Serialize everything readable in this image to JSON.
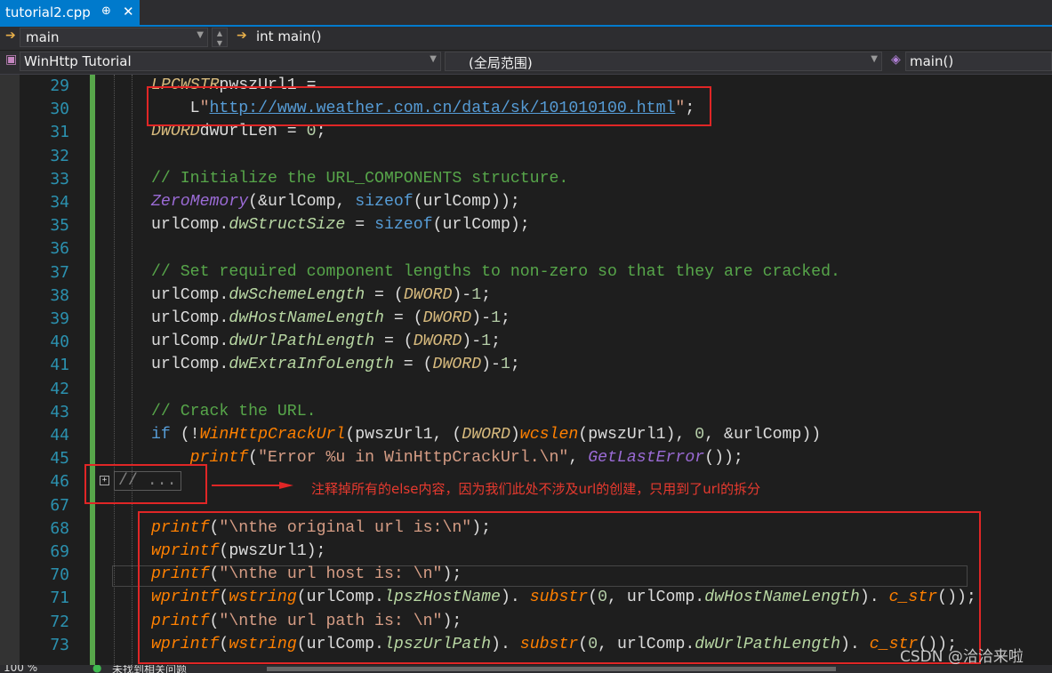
{
  "tab": {
    "title": "tutorial2.cpp",
    "pin": "⊕",
    "close": "✕"
  },
  "nav1": {
    "scope": "main",
    "function": "int main()"
  },
  "nav2": {
    "project": "WinHttp Tutorial",
    "scope": "(全局范围)",
    "member": "main()"
  },
  "code_lines": [
    {
      "num": "29",
      "tokens": [
        [
          "t",
          "LPCWSTR"
        ],
        [
          "",
          "pwszUrl1 ="
        ]
      ]
    },
    {
      "num": "30",
      "indent": 4,
      "tokens": [
        [
          "",
          "L"
        ],
        [
          "s",
          "\""
        ],
        [
          "u",
          "http://www.weather.com.cn/data/sk/101010100.html"
        ],
        [
          "s",
          "\""
        ],
        [
          "",
          ";"
        ]
      ]
    },
    {
      "num": "31",
      "tokens": [
        [
          "t",
          "DWORD"
        ],
        [
          "",
          "dwUrlLen = "
        ],
        [
          "n",
          "0"
        ],
        [
          "",
          ";"
        ]
      ]
    },
    {
      "num": "32",
      "tokens": []
    },
    {
      "num": "33",
      "tokens": [
        [
          "c",
          "// Initialize the URL_COMPONENTS structure."
        ]
      ]
    },
    {
      "num": "34",
      "tokens": [
        [
          "m",
          "ZeroMemory"
        ],
        [
          "",
          "(&urlComp, "
        ],
        [
          "k",
          "sizeof"
        ],
        [
          "",
          "(urlComp));"
        ]
      ]
    },
    {
      "num": "35",
      "tokens": [
        [
          "",
          "urlComp."
        ],
        [
          "v",
          "dwStructSize"
        ],
        [
          "",
          " = "
        ],
        [
          "k",
          "sizeof"
        ],
        [
          "",
          "(urlComp);"
        ]
      ]
    },
    {
      "num": "36",
      "tokens": []
    },
    {
      "num": "37",
      "tokens": [
        [
          "c",
          "// Set required component lengths to non-zero so that they are cracked."
        ]
      ]
    },
    {
      "num": "38",
      "tokens": [
        [
          "",
          "urlComp."
        ],
        [
          "v",
          "dwSchemeLength"
        ],
        [
          "",
          " = ("
        ],
        [
          "t",
          "DWORD"
        ],
        [
          "",
          ")-"
        ],
        [
          "n",
          "1"
        ],
        [
          "",
          ";"
        ]
      ]
    },
    {
      "num": "39",
      "tokens": [
        [
          "",
          "urlComp."
        ],
        [
          "v",
          "dwHostNameLength"
        ],
        [
          "",
          " = ("
        ],
        [
          "t",
          "DWORD"
        ],
        [
          "",
          ")-"
        ],
        [
          "n",
          "1"
        ],
        [
          "",
          ";"
        ]
      ]
    },
    {
      "num": "40",
      "tokens": [
        [
          "",
          "urlComp."
        ],
        [
          "v",
          "dwUrlPathLength"
        ],
        [
          "",
          " = ("
        ],
        [
          "t",
          "DWORD"
        ],
        [
          "",
          ")-"
        ],
        [
          "n",
          "1"
        ],
        [
          "",
          ";"
        ]
      ]
    },
    {
      "num": "41",
      "tokens": [
        [
          "",
          "urlComp."
        ],
        [
          "v",
          "dwExtraInfoLength"
        ],
        [
          "",
          " = ("
        ],
        [
          "t",
          "DWORD"
        ],
        [
          "",
          ")-"
        ],
        [
          "n",
          "1"
        ],
        [
          "",
          ";"
        ]
      ]
    },
    {
      "num": "42",
      "tokens": []
    },
    {
      "num": "43",
      "tokens": [
        [
          "c",
          "// Crack the URL."
        ]
      ]
    },
    {
      "num": "44",
      "tokens": [
        [
          "k",
          "if"
        ],
        [
          "",
          " (!"
        ],
        [
          "f",
          "WinHttpCrackUrl"
        ],
        [
          "",
          "(pwszUrl1, ("
        ],
        [
          "t",
          "DWORD"
        ],
        [
          "",
          ")"
        ],
        [
          "f",
          "wcslen"
        ],
        [
          "",
          "(pwszUrl1), "
        ],
        [
          "n",
          "0"
        ],
        [
          "",
          ", &urlComp))"
        ]
      ]
    },
    {
      "num": "45",
      "indent": 4,
      "tokens": [
        [
          "f",
          "printf"
        ],
        [
          "",
          "("
        ],
        [
          "s",
          "\"Error %u in WinHttpCrackUrl.\\n\""
        ],
        [
          "",
          ", "
        ],
        [
          "m",
          "GetLastError"
        ],
        [
          "",
          "());"
        ]
      ]
    },
    {
      "num": "46",
      "tokens": [],
      "collapsed": "// ..."
    },
    {
      "num": "67",
      "tokens": []
    },
    {
      "num": "68",
      "tokens": [
        [
          "f",
          "printf"
        ],
        [
          "",
          "("
        ],
        [
          "s",
          "\"\\nthe original url is:\\n\""
        ],
        [
          "",
          ");"
        ]
      ]
    },
    {
      "num": "69",
      "tokens": [
        [
          "f",
          "wprintf"
        ],
        [
          "",
          "(pwszUrl1);"
        ]
      ]
    },
    {
      "num": "70",
      "tokens": [
        [
          "f",
          "printf"
        ],
        [
          "",
          "("
        ],
        [
          "s",
          "\"\\nthe url host is: \\n\""
        ],
        [
          "",
          ");"
        ]
      ]
    },
    {
      "num": "71",
      "tokens": [
        [
          "f",
          "wprintf"
        ],
        [
          "",
          "("
        ],
        [
          "f",
          "wstring"
        ],
        [
          "",
          "(urlComp."
        ],
        [
          "v",
          "lpszHostName"
        ],
        [
          "",
          "). "
        ],
        [
          "f",
          "substr"
        ],
        [
          "",
          "("
        ],
        [
          "n",
          "0"
        ],
        [
          "",
          ", urlComp."
        ],
        [
          "v",
          "dwHostNameLength"
        ],
        [
          "",
          "). "
        ],
        [
          "f",
          "c_str"
        ],
        [
          "",
          "());"
        ]
      ]
    },
    {
      "num": "72",
      "tokens": [
        [
          "f",
          "printf"
        ],
        [
          "",
          "("
        ],
        [
          "s",
          "\"\\nthe url path is: \\n\""
        ],
        [
          "",
          ");"
        ]
      ]
    },
    {
      "num": "73",
      "tokens": [
        [
          "f",
          "wprintf"
        ],
        [
          "",
          "("
        ],
        [
          "f",
          "wstring"
        ],
        [
          "",
          "(urlComp."
        ],
        [
          "v",
          "lpszUrlPath"
        ],
        [
          "",
          "). "
        ],
        [
          "f",
          "substr"
        ],
        [
          "",
          "("
        ],
        [
          "n",
          "0"
        ],
        [
          "",
          ", urlComp."
        ],
        [
          "v",
          "dwUrlPathLength"
        ],
        [
          "",
          "). "
        ],
        [
          "f",
          "c_str"
        ],
        [
          "",
          "());"
        ]
      ]
    }
  ],
  "annotation": "注释掉所有的else内容，因为我们此处不涉及url的创建，只用到了url的拆分",
  "status": {
    "zoom": "100 %",
    "message": "未找到相关问题"
  },
  "watermark": "CSDN @洽洽来啦",
  "colors": {
    "accent": "#007acc",
    "annotation_red": "#e02626",
    "editor_bg": "#1e1e1e"
  }
}
